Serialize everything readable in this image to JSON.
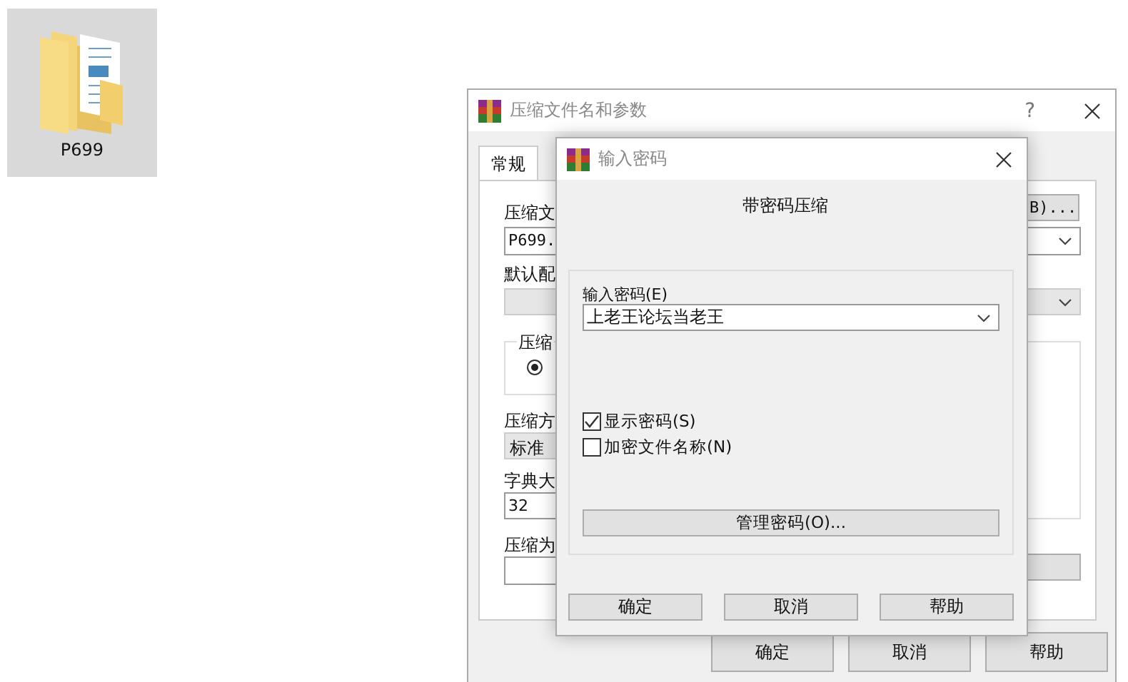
{
  "desktop_icons": [
    {
      "label": "P699",
      "selected": true
    }
  ],
  "back_dialog": {
    "title": "压缩文件名和参数",
    "help": "?",
    "tabs": [
      {
        "label": "常规",
        "selected": true
      }
    ],
    "archive_name_label": "压缩文",
    "archive_name": "P699.",
    "browse_button": "B)...",
    "profile_label": "默认配",
    "group_label": "压缩",
    "radio": {
      "selected": true
    },
    "method_label": "压缩方",
    "method": "标准",
    "dict_label": "字典大",
    "dict": "32",
    "split_label": "压缩为",
    "buttons": [
      "确定",
      "取消",
      "帮助"
    ]
  },
  "password_dialog": {
    "title": "输入密码",
    "heading": "带密码压缩",
    "password_label": "输入密码(E)",
    "password": "上老王论坛当老王",
    "checkboxes": [
      {
        "label": "显示密码(S)",
        "checked": true
      },
      {
        "label": "加密文件名称(N)",
        "checked": false
      }
    ],
    "manage_button": "管理密码(O)...",
    "buttons": [
      "确定",
      "取消",
      "帮助"
    ]
  }
}
